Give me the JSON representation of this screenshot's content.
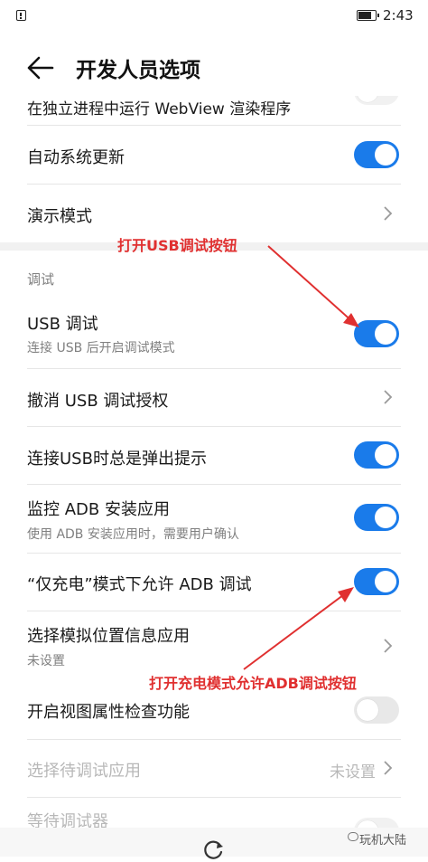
{
  "status_bar": {
    "time": "2:43",
    "battery_level": 0.7
  },
  "header": {
    "title": "开发人员选项"
  },
  "rows": {
    "webview": {
      "label": "在独立进程中运行 WebView 渲染程序"
    },
    "auto_update": {
      "label": "自动系统更新",
      "enabled": true
    },
    "demo_mode": {
      "label": "演示模式"
    },
    "debug_section": {
      "label": "调试"
    },
    "usb_debug": {
      "label": "USB 调试",
      "subtitle": "连接 USB 后开启调试模式",
      "enabled": true
    },
    "revoke_usb": {
      "label": "撤消 USB 调试授权"
    },
    "usb_prompt": {
      "label": "连接USB时总是弹出提示",
      "enabled": true
    },
    "adb_install": {
      "label": "监控 ADB 安装应用",
      "subtitle": "使用 ADB 安装应用时，需要用户确认",
      "enabled": true
    },
    "charge_adb": {
      "label": "“仅充电”模式下允许 ADB 调试",
      "enabled": true
    },
    "mock_location": {
      "label": "选择模拟位置信息应用",
      "subtitle": "未设置"
    },
    "view_attr": {
      "label": "开启视图属性检查功能",
      "enabled": false
    },
    "debug_app": {
      "label": "选择待调试应用",
      "value": "未设置"
    },
    "wait_debugger": {
      "label": "等待调试器",
      "enabled": false
    }
  },
  "annotations": {
    "usb_note": "打开USB调试按钮",
    "adb_note": "打开充电模式允许ADB调试按钮",
    "color": "#e03030"
  },
  "watermark": {
    "text": "玩机大陆"
  },
  "colors": {
    "toggle_on": "#1a7bea",
    "toggle_off": "#e8e8e8"
  }
}
